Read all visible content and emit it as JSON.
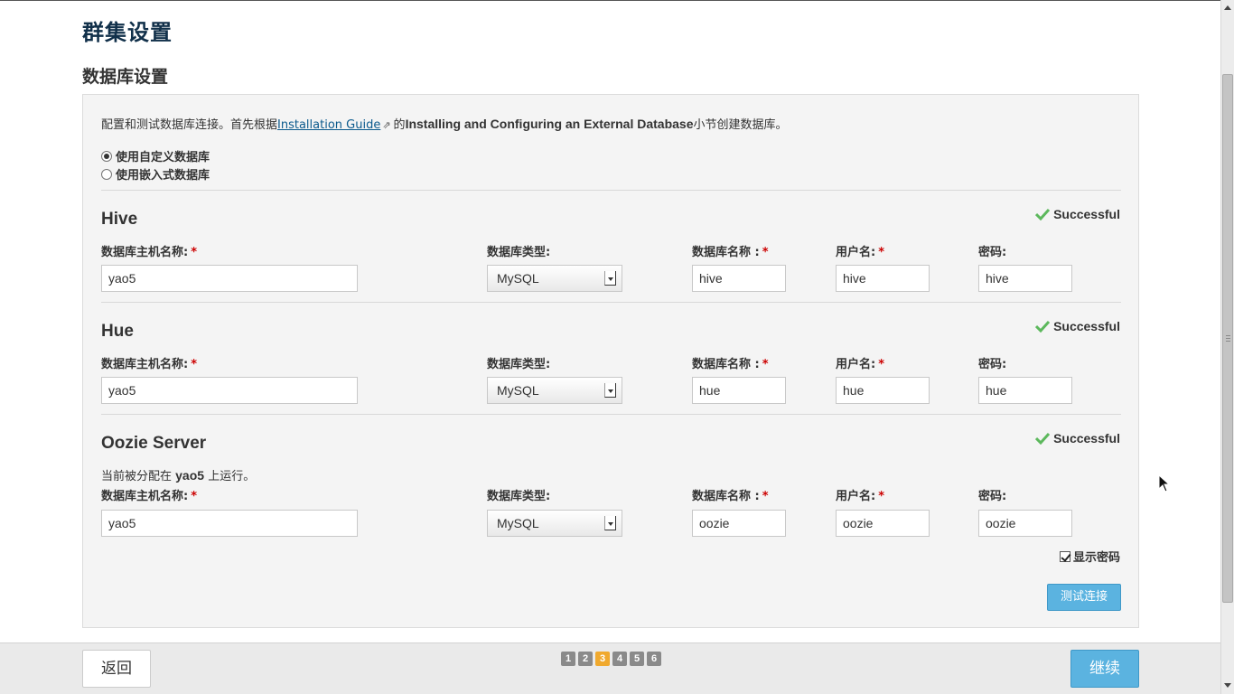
{
  "page": {
    "title": "群集设置",
    "section_title": "数据库设置"
  },
  "intro": {
    "text_before": "配置和测试数据库连接。首先根据",
    "link_text": "Installation Guide",
    "link_icon": "external-link-icon",
    "connector": "的",
    "bold_text": "Installing and Configuring an External Database",
    "text_after": "小节创建数据库。"
  },
  "db_mode": {
    "options": [
      {
        "label": "使用自定义数据库",
        "selected": true
      },
      {
        "label": "使用嵌入式数据库",
        "selected": false
      }
    ]
  },
  "labels": {
    "host": "数据库主机名称:",
    "type": "数据库类型:",
    "name": "数据库名称 :",
    "user": "用户名:",
    "password": "密码:",
    "required_mark": "*"
  },
  "services": [
    {
      "name": "Hive",
      "status": "Successful",
      "host": "yao5",
      "db_type": "MySQL",
      "db_name": "hive",
      "user": "hive",
      "password": "hive"
    },
    {
      "name": "Hue",
      "status": "Successful",
      "host": "yao5",
      "db_type": "MySQL",
      "db_name": "hue",
      "user": "hue",
      "password": "hue"
    },
    {
      "name": "Oozie Server",
      "status": "Successful",
      "assigned_prefix": "当前被分配在 ",
      "assigned_host": "yao5",
      "assigned_suffix": " 上运行。",
      "host": "yao5",
      "db_type": "MySQL",
      "db_name": "oozie",
      "user": "oozie",
      "password": "oozie"
    }
  ],
  "show_password": {
    "label": "显示密码",
    "checked": true
  },
  "test_button": "测试连接",
  "footer": {
    "back": "返回",
    "next": "继续",
    "steps": [
      "1",
      "2",
      "3",
      "4",
      "5",
      "6"
    ],
    "active_step": "3"
  },
  "colors": {
    "primary_button": "#5bb3e0",
    "active_step": "#f0a92e",
    "success_check": "#5cb85c",
    "required": "#cc0000",
    "title": "#11304a"
  }
}
